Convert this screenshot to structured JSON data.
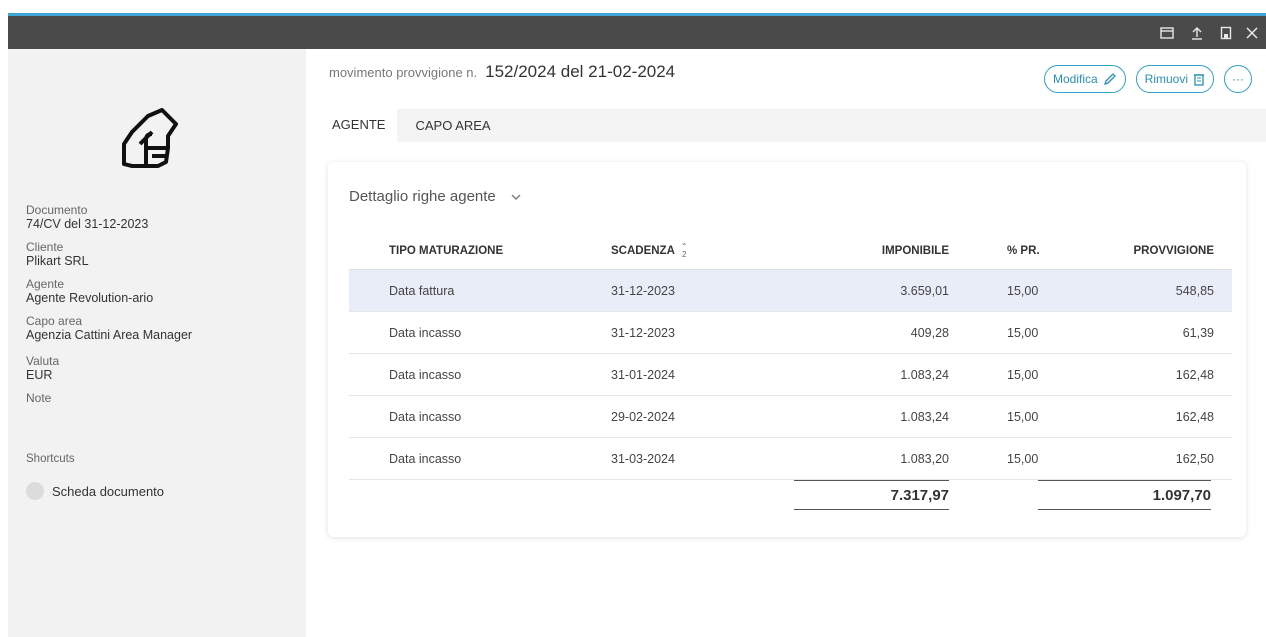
{
  "window": {
    "buttons": [
      {
        "name": "maximize-icon",
        "glyph": "▭"
      },
      {
        "name": "upload-icon",
        "glyph": "↥"
      },
      {
        "name": "save-icon",
        "glyph": "▣"
      },
      {
        "name": "close-icon",
        "glyph": "✕"
      }
    ]
  },
  "sidebar": {
    "icon": "hand-document-icon",
    "fields": [
      {
        "label": "Documento",
        "value": "74/CV del 31-12-2023"
      },
      {
        "label": "Cliente",
        "value": "Plikart SRL"
      },
      {
        "label": "Agente",
        "value": "Agente Revolution-ario"
      },
      {
        "label": "Capo area",
        "value": "Agenzia Cattini Area Manager"
      },
      {
        "label": "Valuta",
        "value": "EUR"
      },
      {
        "label": "Note",
        "value": ""
      }
    ],
    "shortcuts_title": "Shortcuts",
    "shortcuts": [
      {
        "label": "Scheda documento"
      }
    ]
  },
  "header": {
    "prefix": "movimento provvigione n.",
    "number": "152/2024 del 21-02-2024",
    "actions": {
      "edit": "Modifica",
      "remove": "Rimuovi",
      "more": "···"
    }
  },
  "tabs": [
    {
      "label": "AGENTE",
      "active": true
    },
    {
      "label": "CAPO AREA",
      "active": false
    }
  ],
  "card": {
    "title": "Dettaglio righe agente",
    "columns": {
      "tipo": "TIPO MATURAZIONE",
      "scadenza": "SCADENZA",
      "sort_index": "2",
      "imponibile": "IMPONIBILE",
      "pr": "% PR.",
      "provvigione": "PROVVIGIONE"
    },
    "rows": [
      {
        "tipo": "Data fattura",
        "scadenza": "31-12-2023",
        "imponibile": "3.659,01",
        "pr": "15,00",
        "provvigione": "548,85"
      },
      {
        "tipo": "Data incasso",
        "scadenza": "31-12-2023",
        "imponibile": "409,28",
        "pr": "15,00",
        "provvigione": "61,39"
      },
      {
        "tipo": "Data incasso",
        "scadenza": "31-01-2024",
        "imponibile": "1.083,24",
        "pr": "15,00",
        "provvigione": "162,48"
      },
      {
        "tipo": "Data incasso",
        "scadenza": "29-02-2024",
        "imponibile": "1.083,24",
        "pr": "15,00",
        "provvigione": "162,48"
      },
      {
        "tipo": "Data incasso",
        "scadenza": "31-03-2024",
        "imponibile": "1.083,20",
        "pr": "15,00",
        "provvigione": "162,50"
      }
    ],
    "totals": {
      "imponibile": "7.317,97",
      "provvigione": "1.097,70"
    }
  },
  "colors": {
    "accent": "#2ea0c9",
    "selected_row": "#e8edf8",
    "titlebar": "#4a4a4a"
  }
}
